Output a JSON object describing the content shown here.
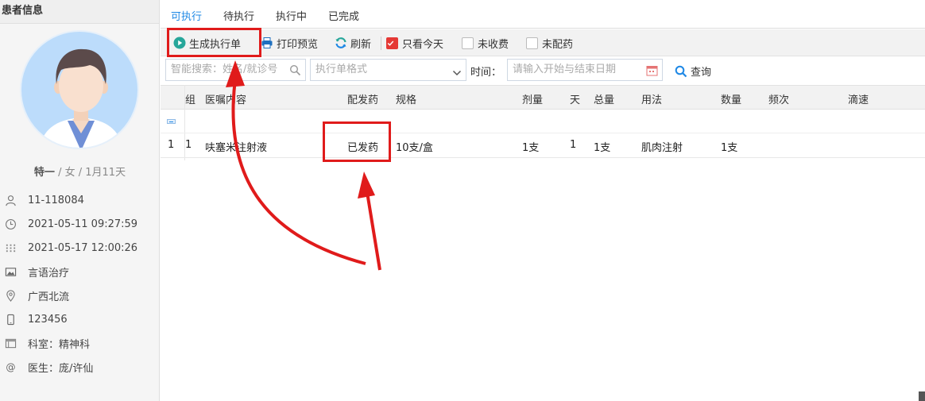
{
  "sidebar": {
    "title": "患者信息",
    "patient": {
      "name": "特一",
      "gender": "女",
      "age": "1月11天"
    },
    "info": [
      {
        "icon": "user-icon",
        "text": "11-118084"
      },
      {
        "icon": "clock-icon",
        "text": "2021-05-11 09:27:59"
      },
      {
        "icon": "calendar-icon",
        "text": "2021-05-17 12:00:26"
      },
      {
        "icon": "image-icon",
        "text": "言语治疗"
      },
      {
        "icon": "location-icon",
        "text": "广西北流"
      },
      {
        "icon": "phone-icon",
        "text": "123456"
      },
      {
        "icon": "department-icon",
        "text": "科室：精神科"
      },
      {
        "icon": "at-icon",
        "text": "医生：庞/许仙"
      }
    ]
  },
  "tabs": [
    {
      "label": "可执行",
      "active": true
    },
    {
      "label": "待执行",
      "active": false
    },
    {
      "label": "执行中",
      "active": false
    },
    {
      "label": "已完成",
      "active": false
    }
  ],
  "toolbar": {
    "generate_label": "生成执行单",
    "print_label": "打印预览",
    "refresh_label": "刷新",
    "today_only_label": "只看今天",
    "today_only_checked": true,
    "unpaid_label": "未收费",
    "unpaid_checked": false,
    "undispensed_label": "未配药",
    "undispensed_checked": false
  },
  "filters": {
    "search_placeholder": "智能搜索：姓名/就诊号",
    "format_placeholder": "执行单格式",
    "time_label": "时间：",
    "date_placeholder": "请输入开始与结束日期",
    "query_label": "查询"
  },
  "table": {
    "columns": [
      "组",
      "医嘱内容",
      "配发药",
      "规格",
      "剂量",
      "天",
      "总量",
      "用法",
      "数量",
      "频次",
      "滴速"
    ],
    "rows": [
      {
        "index": "1",
        "group": "1",
        "content": "呋塞米注射液",
        "dispense": "已发药",
        "spec": "10支/盒",
        "dose": "1支",
        "days": "1",
        "total": "1支",
        "usage": "肌肉注射",
        "qty": "1支",
        "freq": "",
        "drip": ""
      }
    ]
  },
  "colors": {
    "accent": "#1e88e5",
    "highlight": "#e01b1b",
    "checkbox_checked": "#e53935"
  }
}
